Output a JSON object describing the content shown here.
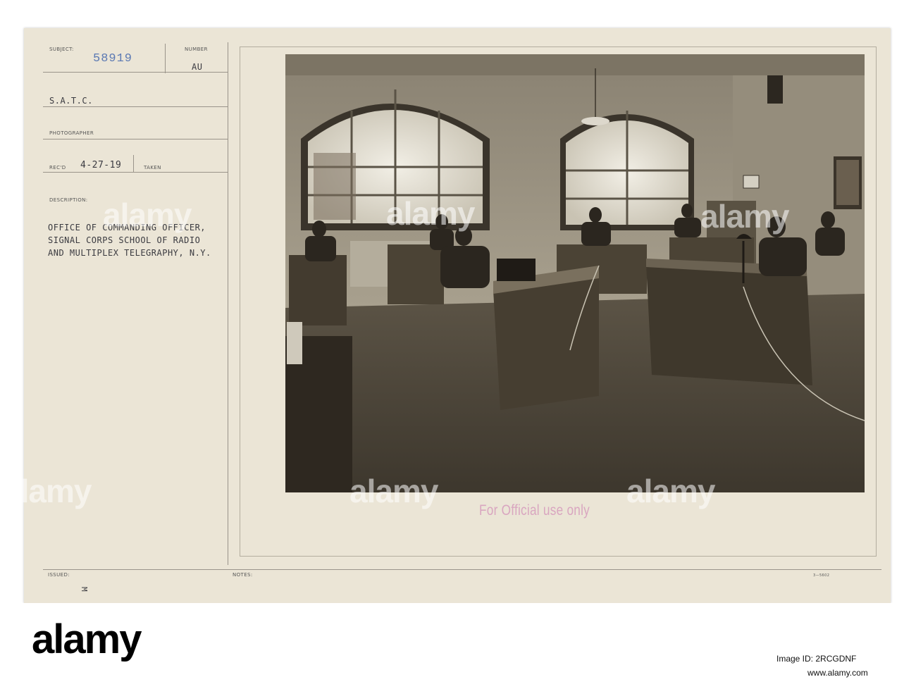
{
  "card": {
    "subject_label": "SUBJECT:",
    "number_label": "NUMBER",
    "number_stamp": "58919",
    "number_suffix": "AU",
    "subject_text": "S.A.T.C.",
    "photographer_label": "PHOTOGRAPHER",
    "recd_label": "REC'D",
    "recd_date": "4-27-19",
    "taken_label": "TAKEN",
    "description_label": "DESCRIPTION:",
    "description_lines": [
      "OFFICE OF COMMANDING OFFICER,",
      "SIGNAL CORPS SCHOOL OF RADIO",
      "AND MULTIPLEX TELEGRAPHY, N.Y."
    ],
    "official_stamp": "For Official use only",
    "issued_label": "ISSUED:",
    "issued_mark": "M",
    "notes_label": "NOTES:",
    "form_number": "3—5602"
  },
  "watermark_text": "alamy",
  "footer": {
    "logo": "alamy",
    "image_id_label": "Image ID: 2RCGDNF",
    "site": "www.alamy.com"
  },
  "colors": {
    "card_background": "#ebe5d6",
    "number_stamp": "#5b79b3",
    "official_stamp": "#d9a6c0",
    "typed_text": "#3a3a40"
  }
}
